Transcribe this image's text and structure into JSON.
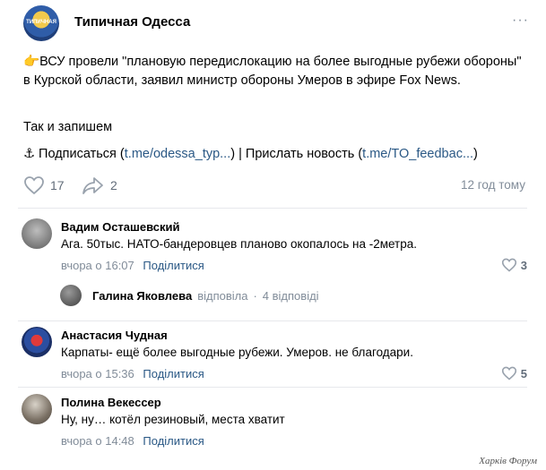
{
  "post": {
    "author": "Типичная Одесса",
    "avatar_caption": "ТИПИЧНАЯ",
    "more_icon": "more-dots-icon",
    "text_emoji": "👉",
    "text_main": "ВСУ провели \"плановую передислокацию на более выгодные рубежи обороны\" в Курской области, заявил министр обороны Умеров в эфире Fox News.",
    "text_line2": "Так и запишем",
    "anchor_emoji": "⚓",
    "subscribe_label": "Подписаться",
    "subscribe_link": "t.me/odessa_typ...",
    "separator": "|",
    "send_news_label": "Прислать новость",
    "send_news_link": "t.me/TO_feedbac...",
    "likes": "17",
    "shares": "2",
    "time": "12 год тому"
  },
  "comments": [
    {
      "name": "Вадим Осташевский",
      "text": "Ага. 50тыс. НАТО-бандеровцев планово окопалось на -2метра.",
      "time": "вчора о 16:07",
      "share_label": "Поділитися",
      "likes": "3"
    },
    {
      "name": "Анастасия Чудная",
      "text": "Карпаты- ещё более выгодные рубежи. Умеров. не благодари.",
      "time": "вчора о 15:36",
      "share_label": "Поділитися",
      "likes": "5"
    },
    {
      "name": "Полина Векессер",
      "text": "Ну, ну… котёл резиновый, места хватит",
      "time": "вчора о 14:48",
      "share_label": "Поділитися",
      "likes": ""
    }
  ],
  "reply": {
    "name": "Галина Яковлева",
    "word": "відповіла",
    "dot": "·",
    "count": "4 відповіді"
  },
  "watermark": "Харків Форум",
  "colors": {
    "link": "#2a5885",
    "muted": "#818c99",
    "icon": "#626d7a",
    "divider": "#e7e8ec"
  }
}
